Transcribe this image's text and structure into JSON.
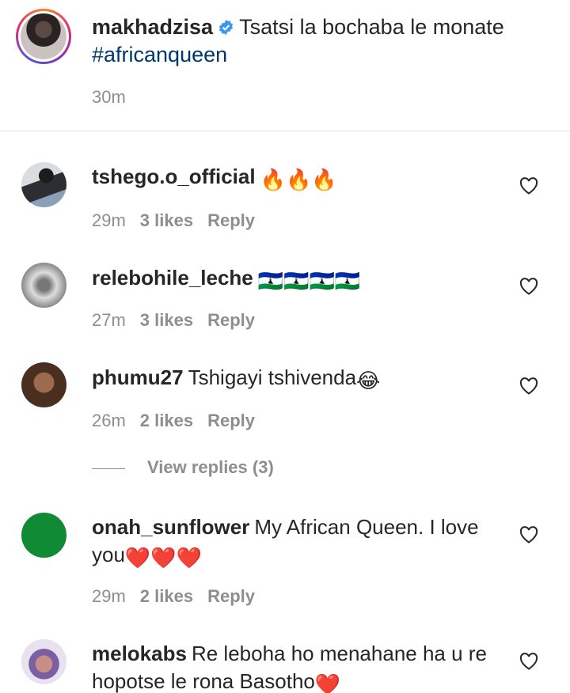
{
  "caption": {
    "username": "makhadzisa",
    "text": "Tsatsi la bochaba le monate",
    "hashtag": "#africanqueen",
    "time": "30m"
  },
  "comments": [
    {
      "username": "tshego.o_official",
      "text": "",
      "emoji": "🔥🔥🔥",
      "time": "29m",
      "likes": "3 likes",
      "reply": "Reply"
    },
    {
      "username": "relebohile_leche",
      "text": "",
      "emoji": "🇱🇸🇱🇸🇱🇸🇱🇸",
      "time": "27m",
      "likes": "3 likes",
      "reply": "Reply"
    },
    {
      "username": "phumu27",
      "text": "Tshigayi tshivenda",
      "emoji": "😂",
      "time": "26m",
      "likes": "2 likes",
      "reply": "Reply"
    },
    {
      "username": "onah_sunflower",
      "text": "My African Queen. I love you",
      "emoji": "❤️❤️❤️",
      "time": "29m",
      "likes": "2 likes",
      "reply": "Reply"
    },
    {
      "username": "melokabs",
      "text": "Re leboha ho menahane ha u re hopotse le rona Basotho",
      "emoji": "❤️",
      "time": "",
      "likes": "",
      "reply": ""
    }
  ],
  "view_replies": "View replies (3)",
  "colors": {
    "link": "#00376b",
    "muted": "#8e8e8e",
    "verified": "#3897f0"
  }
}
